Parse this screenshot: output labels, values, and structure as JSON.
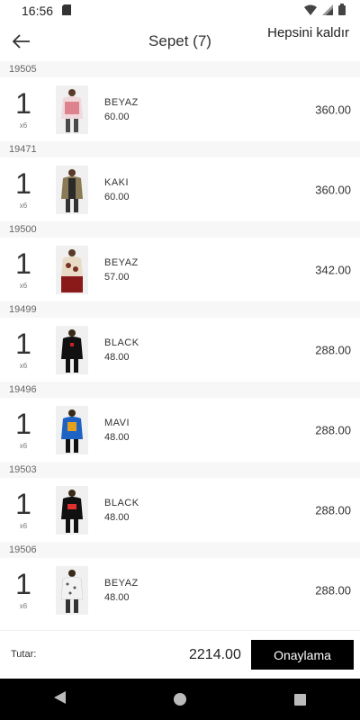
{
  "status": {
    "time": "16:56"
  },
  "header": {
    "title": "Sepet (7)",
    "remove_all": "Hepsini kaldır"
  },
  "items": [
    {
      "code": "19505",
      "qty": "1",
      "qty_sub": "x6",
      "color": "BEYAZ",
      "unit_price": "60.00",
      "total": "360.00"
    },
    {
      "code": "19471",
      "qty": "1",
      "qty_sub": "x6",
      "color": "KAKI",
      "unit_price": "60.00",
      "total": "360.00"
    },
    {
      "code": "19500",
      "qty": "1",
      "qty_sub": "x6",
      "color": "BEYAZ",
      "unit_price": "57.00",
      "total": "342.00"
    },
    {
      "code": "19499",
      "qty": "1",
      "qty_sub": "x6",
      "color": "BLACK",
      "unit_price": "48.00",
      "total": "288.00"
    },
    {
      "code": "19496",
      "qty": "1",
      "qty_sub": "x6",
      "color": "MAVI",
      "unit_price": "48.00",
      "total": "288.00"
    },
    {
      "code": "19503",
      "qty": "1",
      "qty_sub": "x6",
      "color": "BLACK",
      "unit_price": "48.00",
      "total": "288.00"
    },
    {
      "code": "19506",
      "qty": "1",
      "qty_sub": "x6",
      "color": "BEYAZ",
      "unit_price": "48.00",
      "total": "288.00"
    }
  ],
  "footer": {
    "total_label": "Tutar:",
    "total_value": "2214.00",
    "confirm_label": "Onaylama"
  },
  "colors": {
    "primary": "#000000",
    "header_bg": "#f7f7f7"
  }
}
